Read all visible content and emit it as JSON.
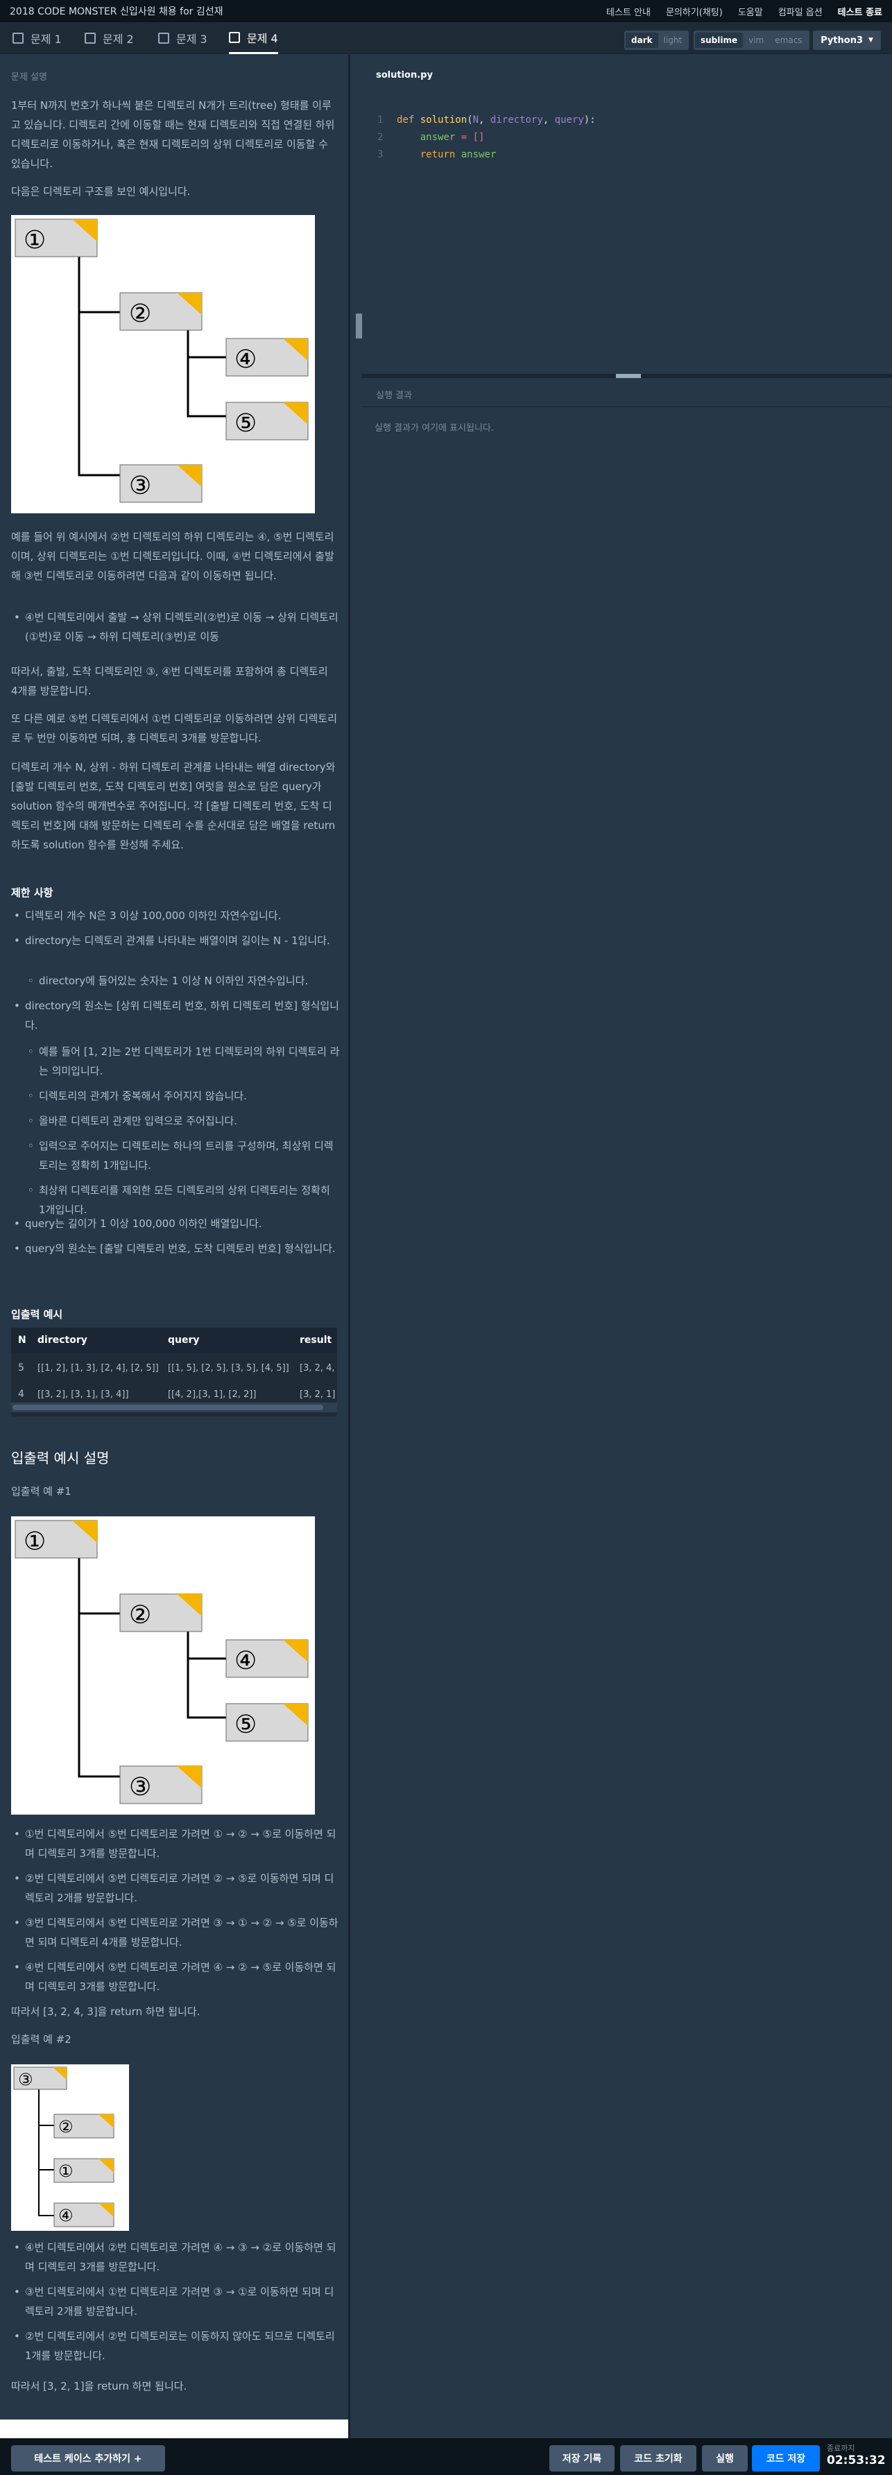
{
  "header": {
    "title": "2018 CODE MONSTER 신입사원 채용 for 김선재",
    "links": [
      "테스트 안내",
      "문의하기(채팅)",
      "도움말",
      "컴파일 옵션"
    ],
    "end_test": "테스트 종료"
  },
  "tabs": [
    {
      "label": "문제 1"
    },
    {
      "label": "문제 2"
    },
    {
      "label": "문제 3"
    },
    {
      "label": "문제 4"
    }
  ],
  "theme": {
    "dark": "dark",
    "light": "light"
  },
  "keymap": {
    "sublime": "sublime",
    "vim": "vim",
    "emacs": "emacs"
  },
  "language": {
    "selected": "Python3"
  },
  "problem": {
    "heading": "문제 설명",
    "intro": "1부터 N까지 번호가 하나씩 붙은 디렉토리 N개가 트리(tree) 형태를 이루고 있습니다. 디렉토리 간에 이동할 때는 현재 디렉토리와 직접 연결된 하위 디렉토리로 이동하거나, 혹은 현재 디렉토리의 상위 디렉토리로 이동할 수 있습니다.",
    "example_intro": "다음은 디렉토리 구조를 보인 예시입니다.",
    "example_desc": "예를 들어 위 예시에서 ②번 디렉토리의 하위 디렉토리는 ④, ⑤번 디렉토리 이며, 상위 디렉토리는 ①번 디렉토리입니다. 이때, ④번 디렉토리에서 출발해 ③번 디렉토리로 이동하려면 다음과 같이 이동하면 됩니다.",
    "example_path": "④번 디렉토리에서 출발 → 상위 디렉토리(②번)로 이동 → 상위 디렉토리(①번)로 이동 → 하위 디렉토리(③번)로 이동",
    "example_conclusion": "따라서, 출발, 도착 디렉토리인 ③, ④번 디렉토리를 포함하여 총 디렉토리 4개를 방문합니다.",
    "example_other": "또 다른 예로 ⑤번 디렉토리에서 ①번 디렉토리로 이동하려면 상위 디렉토리로 두 번만 이동하면 되며, 총 디렉토리 3개를 방문합니다.",
    "task": "디렉토리 개수 N, 상위 - 하위 디렉토리 관계를 나타내는 배열 directory와 [출발 디렉토리 번호, 도착 디렉토리 번호] 여럿을 원소로 담은 query가 solution 함수의 매개변수로 주어집니다. 각 [출발 디렉토리 번호, 도착 디렉토리 번호]에 대해 방문하는 디렉토리 수를 순서대로 담은 배열을 return 하도록 solution 함수를 완성해 주세요."
  },
  "constraints": {
    "heading": "제한 사항",
    "c1": "디렉토리 개수 N은 3 이상 100,000 이하인 자연수입니다.",
    "c2": "directory는 디렉토리 관계를 나타내는 배열이며 길이는 N - 1입니다.",
    "c2a": "directory에 들어있는 숫자는 1 이상 N 이하인 자연수입니다.",
    "c3": "directory의 원소는 [상위 디렉토리 번호, 하위 디렉토리 번호] 형식입니다.",
    "c3a": "예를 들어 [1, 2]는 2번 디렉토리가 1번 디렉토리의 하위 디렉토리 라는 의미입니다.",
    "c3b": "디렉토리의 관계가 중복해서 주어지지 않습니다.",
    "c3c": "올바른 디렉토리 관계만 입력으로 주어집니다.",
    "c3d": "입력으로 주어지는 디렉토리는 하나의 트리를 구성하며, 최상위 디렉토리는 정확히 1개입니다.",
    "c3e": "최상위 디렉토리를 제외한 모든 디렉토리의 상위 디렉토리는 정확히 1개입니다.",
    "c4": "query는 길이가 1 이상 100,000 이하인 배열입니다.",
    "c5": "query의 원소는 [출발 디렉토리 번호, 도착 디렉토리 번호] 형식입니다."
  },
  "io_example": {
    "heading": "입출력 예시",
    "columns": [
      "N",
      "directory",
      "query",
      "result"
    ],
    "rows": [
      [
        "5",
        "[[1, 2], [1, 3], [2, 4], [2, 5]]",
        "[[1, 5], [2, 5], [3, 5], [4, 5]]",
        "[3, 2, 4,"
      ],
      [
        "4",
        "[[3, 2], [3, 1], [3, 4]]",
        "[[4, 2],[3, 1], [2, 2]]",
        "[3, 2, 1]"
      ]
    ]
  },
  "io_explain": {
    "heading": "입출력 예시 설명",
    "ex1_label": "입출력 예 #1",
    "ex1_items": [
      "①번 디렉토리에서 ⑤번 디렉토리로 가려면 ① → ② → ⑤로 이동하면 되며 디렉토리 3개를 방문합니다.",
      "②번 디렉토리에서 ⑤번 디렉토리로 가려면 ② → ⑤로 이동하면 되며 디렉토리 2개를 방문합니다.",
      "③번 디렉토리에서 ⑤번 디렉토리로 가려면 ③ → ① → ② → ⑤로 이동하면 되며 디렉토리 4개를 방문합니다.",
      "④번 디렉토리에서 ⑤번 디렉토리로 가려면 ④ → ② → ⑤로 이동하면 되며 디렉토리 3개를 방문합니다."
    ],
    "ex1_result": "따라서 [3, 2, 4, 3]을 return 하면 됩니다.",
    "ex2_label": "입출력 예 #2",
    "ex2_items": [
      "④번 디렉토리에서 ②번 디렉토리로 가려면 ④ → ③ → ②로 이동하면 되며 디렉토리 3개를 방문합니다.",
      "③번 디렉토리에서 ①번 디렉토리로 가려면 ③ → ①로 이동하면 되며 디렉토리 2개를 방문합니다.",
      "②번 디렉토리에서 ②번 디렉토리로는 이동하지 않아도 되므로 디렉토리 1개를 방문합니다."
    ],
    "ex2_result": "따라서 [3, 2, 1]을 return 하면 됩니다."
  },
  "tree1": {
    "root": "①",
    "n2": "②",
    "n3": "③",
    "n4": "④",
    "n5": "⑤"
  },
  "tree2": {
    "root": "③",
    "n2": "②",
    "n1": "①",
    "n4": "④"
  },
  "editor": {
    "filename": "solution.py",
    "line_numbers": [
      "1",
      "2",
      "3"
    ],
    "code": {
      "def": "def",
      "fname": "solution",
      "open": "(",
      "a1": "N",
      "a2": "directory",
      "a3": "query",
      "close": "):",
      "answer": "answer",
      "assign": " = []",
      "ret": "return",
      "answer2": "answer"
    }
  },
  "result": {
    "heading": "실행 결과",
    "placeholder": "실행 결과가 여기에 표시됩니다."
  },
  "footer": {
    "add_testcase": "테스트 케이스 추가하기 +",
    "save_log": "저장 기록",
    "reset_code": "코드 초기화",
    "run": "실행",
    "save_code": "코드 저장",
    "time_label": "종료까지",
    "time_left": "02:53:32"
  },
  "colors": {
    "background": "#263747",
    "topbar": "#0c151c",
    "accent": "#0078ff",
    "folder_tab": "#f5b400"
  }
}
